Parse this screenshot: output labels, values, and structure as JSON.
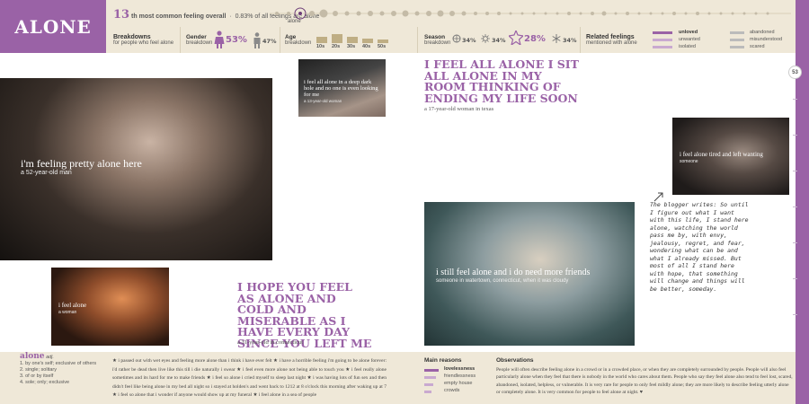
{
  "title": "ALONE",
  "rank": {
    "number": "13",
    "suffix": "th most common feeling overall",
    "share": "0.83% of all feelings are alone"
  },
  "dot_label": "alone",
  "breakdowns": {
    "heading": "Breakdowns",
    "sub": "for people who feel alone"
  },
  "gender": {
    "heading": "Gender",
    "sub": "breakdown",
    "female_pct": "53%",
    "male_pct": "47%"
  },
  "age": {
    "heading": "Age",
    "sub": "breakdown",
    "groups": [
      "10s",
      "20s",
      "30s",
      "40s",
      "50s"
    ],
    "levels": [
      0.55,
      0.8,
      0.6,
      0.45,
      0.35
    ]
  },
  "season": {
    "heading": "Season",
    "sub": "breakdown",
    "values": [
      "34%",
      "34%",
      "28%",
      "34%"
    ]
  },
  "related": {
    "heading": "Related feelings",
    "sub": "mentioned with alone",
    "col1": [
      "unloved",
      "unwanted",
      "isolated"
    ],
    "col2": [
      "abandoned",
      "misunderstood",
      "scared"
    ]
  },
  "page_number": "53",
  "photos": {
    "man": {
      "caption": "i'm feeling pretty alone here",
      "sub": "a 52-year-old man"
    },
    "dark": {
      "caption": "i feel all alone in a deep dark hole and no one is even looking for me",
      "sub": "a 13-year-old woman"
    },
    "tired": {
      "caption": "i feel alone tired and left wanting",
      "sub": "someone"
    },
    "girl": {
      "caption": "i still feel alone and i do need more friends",
      "sub": "someone in watertown, connecticut, when it was cloudy"
    },
    "woman": {
      "caption": "i feel alone",
      "sub": "a woman"
    }
  },
  "quote1": {
    "text": "I feel all alone I sit all alone in my room thinking of ending my life soon",
    "attrib": "a 17-year-old woman in texas"
  },
  "quote2": {
    "text": "I hope you feel as alone and cold and miserable as I have every day since you left me",
    "attrib": "a 31-year-old in connecticut"
  },
  "blogger_note": "The blogger writes: So until I figure out what I want with this life, I stand here alone, watching the world pass me by, with envy, jealousy, regret, and fear, wondering what can be and what I already missed. But most of all I stand here with hope, that something will change and things will be better, someday.",
  "definition": {
    "word": "alone",
    "pos": "adj.",
    "senses": [
      "1. by one's self; exclusive of others",
      "2. single; solitary",
      "3. of or by itself",
      "4. sole; only; exclusive"
    ]
  },
  "feelings_text": "★ i passed out with wet eyes and feeling more alone than i think i have ever felt ★ i have a horrible feeling i'm going to be alone forever: i'd rather be dead then live like this till i die naturally i swear ★ i feel even more alone not being able to touch you ★ i feel really alone sometimes and its hard for me to make friends ★ i feel so alone i cried myself to sleep last night ★ i was having lots of fun sex and then didn't feel like being alone in my bed all night so i stayed at holden's and went back to 1212 at 8 o'clock this morning after waking up at 7 ★ i feel so alone that i wonder if anyone would show up at my funeral ★ i feel alone in a sea of people",
  "main_reasons": {
    "heading": "Main reasons",
    "items": [
      "lovelessness",
      "friendlessness",
      "empty house",
      "crowds"
    ],
    "levels": [
      1.0,
      0.8,
      0.65,
      0.5
    ]
  },
  "observations": {
    "heading": "Observations",
    "text": "People will often describe feeling alone in a crowd or in a crowded place, or when they are completely surrounded by people. People will also feel particularly alone when they feel that there is nobody in the world who cares about them. People who say they feel alone also tend to feel lost, scared, abandoned, isolated, helpless, or vulnerable. It is very rare for people to only feel mildly alone; they are more likely to describe feeling utterly alone or completely alone. It is very common for people to feel alone at night. ♥"
  },
  "colors": {
    "accent": "#9a62a6",
    "header_bg": "#efe8d8",
    "tan": "#bfae84"
  }
}
